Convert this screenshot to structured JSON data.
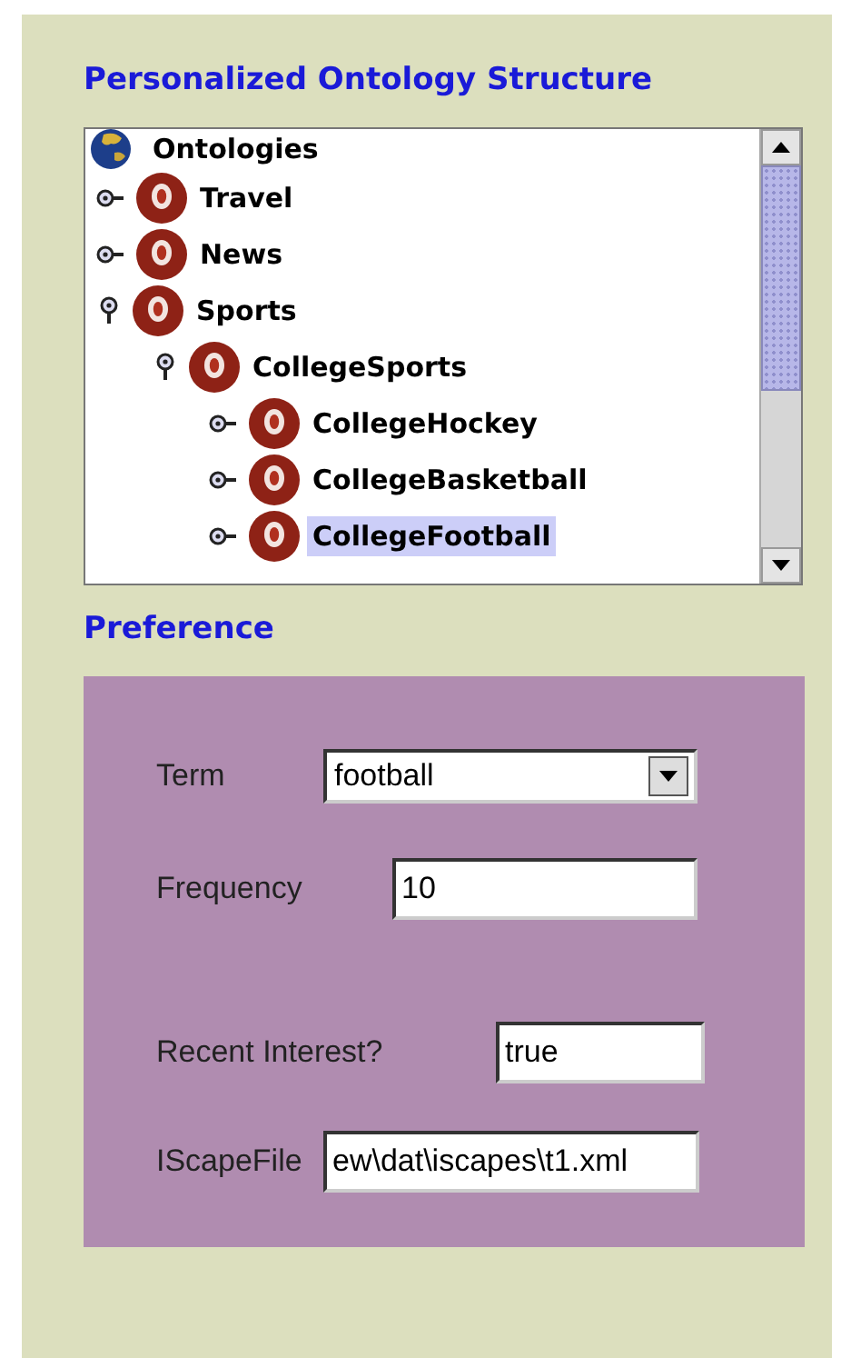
{
  "ontology_panel": {
    "title": "Personalized Ontology Structure",
    "tree": {
      "label": "Ontologies",
      "children": [
        {
          "label": "Travel",
          "expanded": false,
          "selected": false
        },
        {
          "label": "News",
          "expanded": false,
          "selected": false
        },
        {
          "label": "Sports",
          "expanded": true,
          "selected": false,
          "children": [
            {
              "label": "CollegeSports",
              "expanded": true,
              "selected": false,
              "children": [
                {
                  "label": "CollegeHockey",
                  "expanded": false,
                  "selected": false
                },
                {
                  "label": "CollegeBasketball",
                  "expanded": false,
                  "selected": false
                },
                {
                  "label": "CollegeFootball",
                  "expanded": false,
                  "selected": true
                }
              ]
            }
          ]
        }
      ]
    }
  },
  "preference_panel": {
    "title": "Preference",
    "fields": [
      {
        "kind": "dropdown",
        "label": "Term",
        "value": "football"
      },
      {
        "kind": "text",
        "label": "Frequency",
        "value": "10"
      },
      {
        "kind": "text",
        "label": "Recent Interest?",
        "value": "true"
      },
      {
        "kind": "text",
        "label": "IScapeFile",
        "value": "ew\\dat\\iscapes\\t1.xml"
      }
    ]
  }
}
